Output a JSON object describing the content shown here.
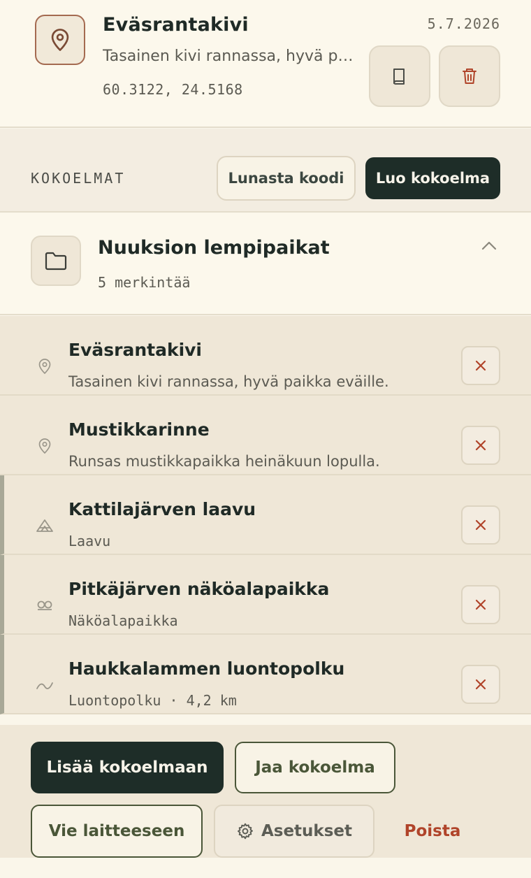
{
  "place": {
    "title": "Eväsrantakivi",
    "description": "Tasainen kivi rannassa, hyvä paikka eväille.",
    "coordinates": "60.3122, 24.5168",
    "date": "5.7.2026"
  },
  "collections_bar": {
    "label": "KOKOELMAT",
    "redeem_label": "Lunasta koodi",
    "create_label": "Luo kokoelma"
  },
  "collection": {
    "name": "Nuuksion lempipaikat",
    "count": "5 merkintää",
    "items": [
      {
        "title": "Eväsrantakivi",
        "subtitle": "Tasainen kivi rannassa, hyvä paikka eväille.",
        "icon": "map-pin-icon"
      },
      {
        "title": "Mustikkarinne",
        "subtitle": "Runsas mustikkapaikka heinäkuun lopulla.",
        "icon": "map-pin-icon"
      },
      {
        "title": "Kattilajärven laavu",
        "subtitle": "Laavu",
        "icon": "shelter-icon"
      },
      {
        "title": "Pitkäjärven näköalapaikka",
        "subtitle": "Näköalapaikka",
        "icon": "binoculars-icon"
      },
      {
        "title": "Haukkalammen luontopolku",
        "subtitle": "Luontopolku · 4,2 km",
        "icon": "trail-icon"
      }
    ]
  },
  "actions": {
    "add_label": "Lisää kokoelmaan",
    "share_label": "Jaa kokoelma",
    "export_label": "Vie laitteeseen",
    "settings_label": "Asetukset",
    "delete_label": "Poista"
  },
  "colors": {
    "accent_dark": "#1e2d28",
    "danger": "#b0442a",
    "pin_brown": "#a46a50",
    "olive": "#4a5638"
  }
}
